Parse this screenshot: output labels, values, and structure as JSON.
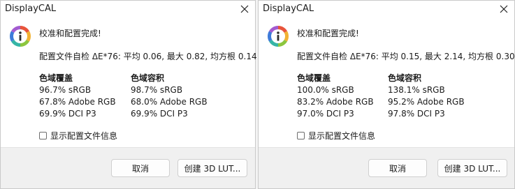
{
  "dialogs": [
    {
      "title": "DisplayCAL",
      "headline": "校准和配置完成!",
      "summary": "配置文件自检 ΔE*76: 平均 0.06, 最大 0.82, 均方根 0.14",
      "coverage": {
        "heading": "色域覆盖",
        "rows": [
          "96.7% sRGB",
          "67.8% Adobe RGB",
          "69.9% DCI P3"
        ]
      },
      "volume": {
        "heading": "色域容积",
        "rows": [
          "98.7% sRGB",
          "68.0% Adobe RGB",
          "69.9% DCI P3"
        ]
      },
      "checkbox_label": "显示配置文件信息",
      "checkbox_checked": false,
      "cancel_label": "取消",
      "lut_label": "创建 3D LUT..."
    },
    {
      "title": "DisplayCAL",
      "headline": "校准和配置完成!",
      "summary": "配置文件自检 ΔE*76: 平均 0.15, 最大 2.14, 均方根 0.30",
      "coverage": {
        "heading": "色域覆盖",
        "rows": [
          "100.0% sRGB",
          "83.2% Adobe RGB",
          "97.0% DCI P3"
        ]
      },
      "volume": {
        "heading": "色域容积",
        "rows": [
          "138.1% sRGB",
          "95.2% Adobe RGB",
          "97.8% DCI P3"
        ]
      },
      "checkbox_label": "显示配置文件信息",
      "checkbox_checked": false,
      "cancel_label": "取消",
      "lut_label": "创建 3D LUT..."
    }
  ],
  "icons": {
    "close": "close-icon",
    "info": "info-icon"
  }
}
